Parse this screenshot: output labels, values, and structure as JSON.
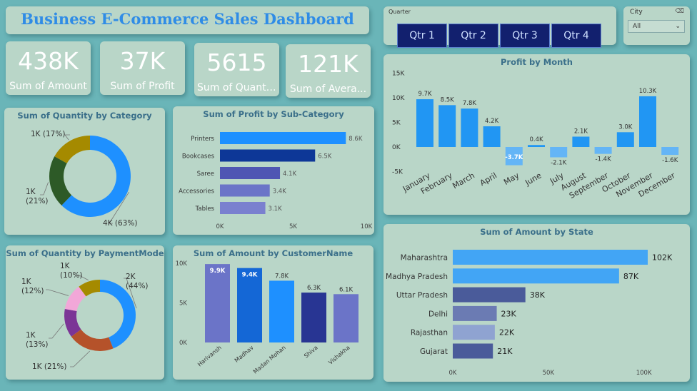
{
  "header": {
    "title": "Business E-Commerce Sales Dashboard"
  },
  "kpis": [
    {
      "value": "438K",
      "label": "Sum of Amount"
    },
    {
      "value": "37K",
      "label": "Sum of Profit"
    },
    {
      "value": "5615",
      "label": "Sum of Quantity"
    },
    {
      "value": "121K",
      "label": "Sum of Avera..."
    }
  ],
  "slicers": {
    "quarter": {
      "label": "Quarter",
      "options": [
        "Qtr 1",
        "Qtr 2",
        "Qtr 3",
        "Qtr 4"
      ]
    },
    "city": {
      "label": "City",
      "value": "All",
      "eraser_icon": "eraser-icon"
    }
  },
  "colors": {
    "card": "#b9d6c8",
    "background": "#6ab5b8",
    "title": "#2f8ce6",
    "profit_bar": "#2196f3",
    "profit_bar_neg": "#64b5f6"
  },
  "chart_data": [
    {
      "id": "qty_by_category",
      "type": "pie",
      "title": "Sum of Quantity by Category",
      "donut": true,
      "slices": [
        {
          "value": 3527,
          "label": "4K (63%)",
          "color": "#1e90ff"
        },
        {
          "value": 1180,
          "label": "1K\n(21%)",
          "color": "#2d5a27"
        },
        {
          "value": 955,
          "label": "1K (17%)",
          "color": "#a58a00"
        }
      ]
    },
    {
      "id": "profit_by_subcategory",
      "type": "bar",
      "orientation": "horizontal",
      "title": "Sum of Profit by Sub-Category",
      "categories": [
        "Printers",
        "Bookcases",
        "Saree",
        "Accessories",
        "Tables"
      ],
      "values": [
        8600,
        6500,
        4100,
        3400,
        3100
      ],
      "value_labels": [
        "8.6K",
        "6.5K",
        "4.1K",
        "3.4K",
        "3.1K"
      ],
      "colors": [
        "#1e90ff",
        "#0d3797",
        "#4f56b3",
        "#6b74c8",
        "#7a80cf"
      ],
      "xlim": [
        0,
        10000
      ],
      "ticks": [
        "0K",
        "5K",
        "10K"
      ]
    },
    {
      "id": "qty_by_paymentmode",
      "type": "pie",
      "title": "Sum of Quantity by PaymentMode",
      "donut": true,
      "slices": [
        {
          "value": 2468,
          "label": "2K\n(44%)",
          "color": "#1e90ff"
        },
        {
          "value": 1175,
          "label": "1K (21%)",
          "color": "#b5522a"
        },
        {
          "value": 730,
          "label": "1K\n(13%)",
          "color": "#7b3596"
        },
        {
          "value": 675,
          "label": "1K\n(12%)",
          "color": "#f2a7d8"
        },
        {
          "value": 567,
          "label": "1K\n(10%)",
          "color": "#a58a00"
        }
      ]
    },
    {
      "id": "amount_by_customer",
      "type": "bar",
      "title": "Sum of Amount by CustomerName",
      "categories": [
        "Harivansh",
        "Madhav",
        "Madan Mohan",
        "Shiva",
        "Vishakha"
      ],
      "values": [
        9900,
        9400,
        7800,
        6300,
        6100
      ],
      "value_labels": [
        "9.9K",
        "9.4K",
        "7.8K",
        "6.3K",
        "6.1K"
      ],
      "colors": [
        "#6b74c8",
        "#1467d6",
        "#1e90ff",
        "#283593",
        "#6b74c8"
      ],
      "ylim": [
        0,
        10000
      ],
      "ticks": [
        "0K",
        "5K",
        "10K"
      ]
    },
    {
      "id": "profit_by_month",
      "type": "bar",
      "title": "Profit by Month",
      "categories": [
        "January",
        "February",
        "March",
        "April",
        "May",
        "June",
        "July",
        "August",
        "September",
        "October",
        "November",
        "December"
      ],
      "values": [
        9700,
        8500,
        7800,
        4200,
        -3700,
        400,
        -2100,
        2100,
        -1400,
        3000,
        10300,
        -1600
      ],
      "value_labels": [
        "9.7K",
        "8.5K",
        "7.8K",
        "4.2K",
        "-3.7K",
        "0.4K",
        "-2.1K",
        "2.1K",
        "-1.4K",
        "3.0K",
        "10.3K",
        "-1.6K"
      ],
      "ylim": [
        -5000,
        15000
      ],
      "ticks": [
        "-5K",
        "0K",
        "5K",
        "10K",
        "15K"
      ]
    },
    {
      "id": "amount_by_state",
      "type": "bar",
      "orientation": "horizontal",
      "title": "Sum of Amount by State",
      "categories": [
        "Maharashtra",
        "Madhya Pradesh",
        "Uttar Pradesh",
        "Delhi",
        "Rajasthan",
        "Gujarat"
      ],
      "values": [
        102000,
        87000,
        38000,
        23000,
        22000,
        21000
      ],
      "value_labels": [
        "102K",
        "87K",
        "38K",
        "23K",
        "22K",
        "21K"
      ],
      "colors": [
        "#42a5f5",
        "#42a5f5",
        "#4a5b9a",
        "#6b7bb3",
        "#8fa3d1",
        "#4a5b9a"
      ],
      "xlim": [
        0,
        102000
      ],
      "ticks": [
        "0K",
        "50K",
        "100K"
      ]
    }
  ]
}
